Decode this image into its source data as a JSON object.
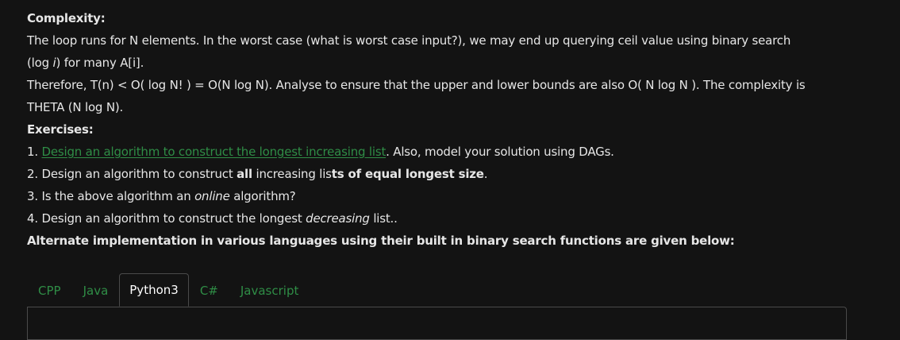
{
  "complexity": {
    "heading": "Complexity:",
    "p1": "The loop runs for N elements. In the worst case (what is worst case input?), we may end up querying ceil value using binary search",
    "p2_a": "(log ",
    "p2_i": "i",
    "p2_b": ") for many A[i].",
    "p3": "Therefore, T(n) < O( log N! )  = O(N log N). Analyse to ensure that the upper and lower bounds are also O( N log N ). The complexity is",
    "p4": "THETA (N log N)."
  },
  "exercises": {
    "heading": "Exercises:",
    "e1_num": "1. ",
    "e1_link": "Design an algorithm to construct the longest increasing list",
    "e1_rest": ". Also, model your solution using DAGs.",
    "e2_a": "2. Design an algorithm to construct ",
    "e2_all": "all",
    "e2_b": " increasing lis",
    "e2_c": "ts of equal longest size",
    "e2_d": ".",
    "e3_a": "3. Is the above algorithm an ",
    "e3_em": "online",
    "e3_b": " algorithm?",
    "e4_a": "4. Design an algorithm to construct the longest ",
    "e4_em": "decreasing",
    "e4_b": " list.."
  },
  "alternate": "Alternate implementation in various languages using their built in binary search functions are given below:",
  "tabs": [
    {
      "label": "CPP"
    },
    {
      "label": "Java"
    },
    {
      "label": "Python3"
    },
    {
      "label": "C#"
    },
    {
      "label": "Javascript"
    }
  ],
  "active_tab": "Python3",
  "colors": {
    "background": "#131313",
    "text": "#e6e6e6",
    "link": "#2f8d46",
    "border": "#4a4a4a"
  }
}
